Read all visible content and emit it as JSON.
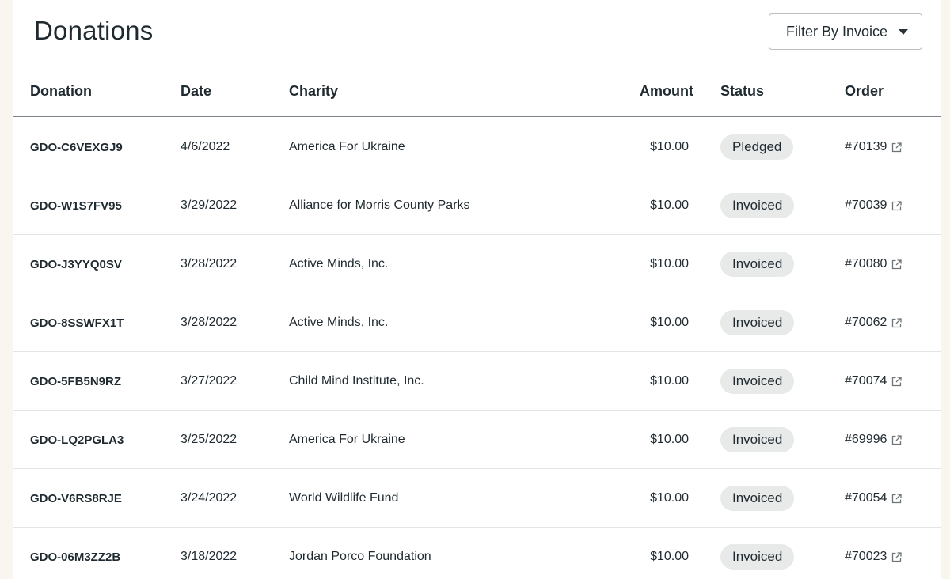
{
  "page": {
    "title": "Donations"
  },
  "filter": {
    "label": "Filter By Invoice"
  },
  "table": {
    "columns": [
      "Donation",
      "Date",
      "Charity",
      "Amount",
      "Status",
      "Order"
    ],
    "rows": [
      {
        "donation": "GDO-C6VEXGJ9",
        "date": "4/6/2022",
        "charity": "America For Ukraine",
        "amount": "$10.00",
        "status": "Pledged",
        "order": "#70139"
      },
      {
        "donation": "GDO-W1S7FV95",
        "date": "3/29/2022",
        "charity": "Alliance for Morris County Parks",
        "amount": "$10.00",
        "status": "Invoiced",
        "order": "#70039"
      },
      {
        "donation": "GDO-J3YYQ0SV",
        "date": "3/28/2022",
        "charity": "Active Minds, Inc.",
        "amount": "$10.00",
        "status": "Invoiced",
        "order": "#70080"
      },
      {
        "donation": "GDO-8SSWFX1T",
        "date": "3/28/2022",
        "charity": "Active Minds, Inc.",
        "amount": "$10.00",
        "status": "Invoiced",
        "order": "#70062"
      },
      {
        "donation": "GDO-5FB5N9RZ",
        "date": "3/27/2022",
        "charity": "Child Mind Institute, Inc.",
        "amount": "$10.00",
        "status": "Invoiced",
        "order": "#70074"
      },
      {
        "donation": "GDO-LQ2PGLA3",
        "date": "3/25/2022",
        "charity": "America For Ukraine",
        "amount": "$10.00",
        "status": "Invoiced",
        "order": "#69996"
      },
      {
        "donation": "GDO-V6RS8RJE",
        "date": "3/24/2022",
        "charity": "World Wildlife Fund",
        "amount": "$10.00",
        "status": "Invoiced",
        "order": "#70054"
      },
      {
        "donation": "GDO-06M3ZZ2B",
        "date": "3/18/2022",
        "charity": "Jordan Porco Foundation",
        "amount": "$10.00",
        "status": "Invoiced",
        "order": "#70023"
      }
    ]
  },
  "icons": {
    "order_link": "external-link-icon",
    "filter_caret": "caret-down-icon"
  }
}
